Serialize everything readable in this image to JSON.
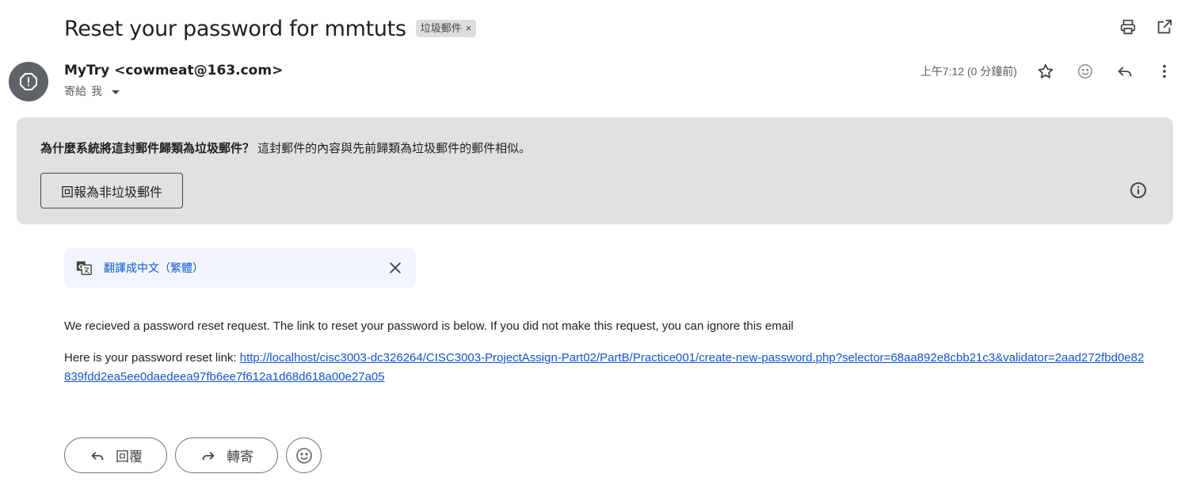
{
  "email": {
    "subject": "Reset your password for mmtuts",
    "label": "垃圾郵件",
    "label_remove": "×",
    "sender": "MyTry <cowmeat@163.com>",
    "recipient_prefix": "寄給",
    "recipient": "我",
    "timestamp": "上午7:12 (0 分鐘前)"
  },
  "spam_banner": {
    "question": "為什麼系統將這封郵件歸類為垃圾郵件？",
    "explanation": " 這封郵件的內容與先前歸類為垃圾郵件的郵件相似。",
    "report_button": "回報為非垃圾郵件"
  },
  "translate": {
    "link": "翻譯成中文（繁體）"
  },
  "body": {
    "paragraph1": "We recieved a password reset request. The link to reset your password is below. If you did not make this request, you can ignore this email",
    "link_prefix": "Here is your password reset link: ",
    "link": "http://localhost/cisc3003-dc326264/CISC3003-ProjectAssign-Part02/PartB/Practice001/create-new-password.php?selector=68aa892e8cbb21c3&validator=2aad272fbd0e82839fdd2ea5ee0daedeea97fb6ee7f612a1d68d618a00e27a05"
  },
  "actions": {
    "reply": "回覆",
    "forward": "轉寄"
  },
  "icons": {
    "print": "print-icon",
    "popout": "open-in-new-window-icon",
    "star": "star-icon",
    "emoji": "emoji-icon",
    "reply": "reply-icon",
    "more": "more-vert-icon",
    "info": "info-icon",
    "translate": "translate-icon",
    "close": "close-icon",
    "spam_avatar": "spam-alert-icon"
  },
  "colors": {
    "link": "#1155cc",
    "translate_link": "#0b57d0",
    "banner_bg": "#e1e1e1",
    "avatar_bg": "#5f6368"
  }
}
